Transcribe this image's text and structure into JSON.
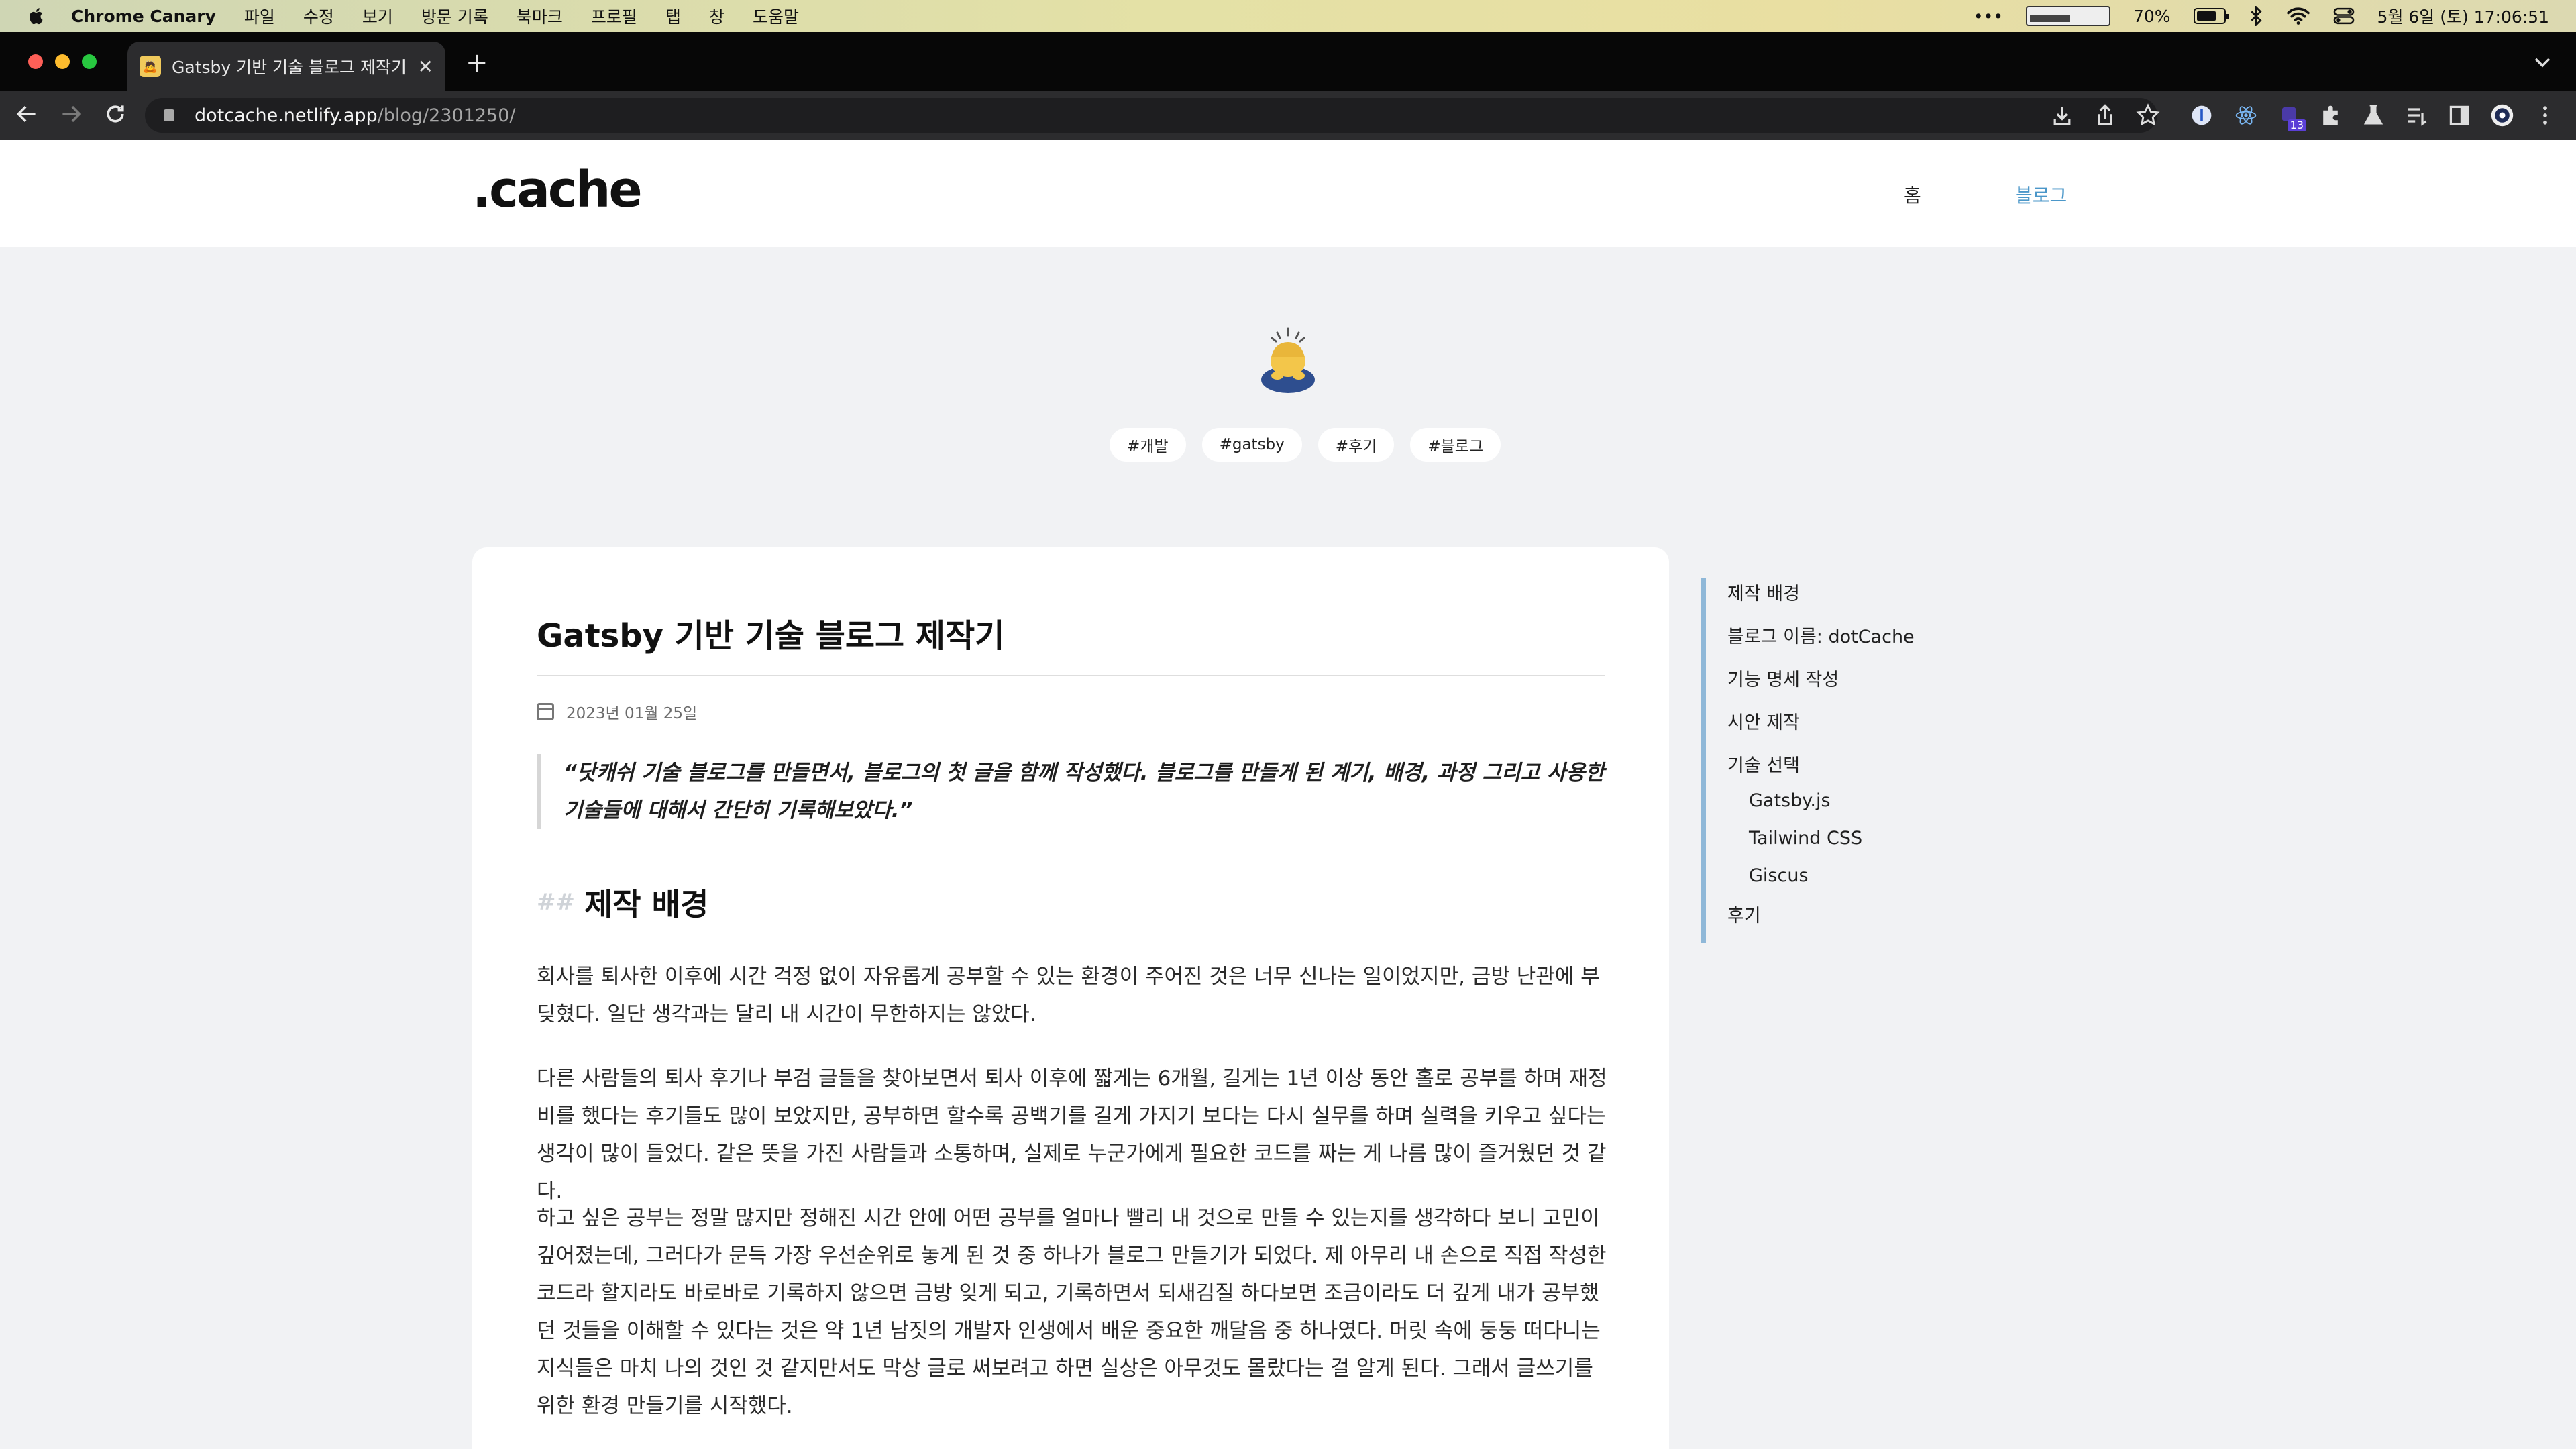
{
  "menubar": {
    "app_name": "Chrome Canary",
    "menus": [
      "파일",
      "수정",
      "보기",
      "방문 기록",
      "북마크",
      "프로필",
      "탭",
      "창",
      "도움말"
    ],
    "more": "•••",
    "battery_percent": "70%",
    "datetime": "5월 6일 (토) 17:06:51"
  },
  "browser": {
    "tab_title": "Gatsby 기반 기술 블로그 제작기 | d",
    "tab_close": "✕",
    "new_tab": "+",
    "url_host": "dotcache.netlify.app",
    "url_path": "/blog/2301250/",
    "extension_badge": "13"
  },
  "site": {
    "logo": ".cache",
    "nav": {
      "home": "홈",
      "blog": "블로그"
    },
    "hero_emoji": "🙇",
    "tags": [
      "#개발",
      "#gatsby",
      "#후기",
      "#블로그"
    ]
  },
  "post": {
    "title": "Gatsby 기반 기술 블로그 제작기",
    "date": "2023년 01월 25일",
    "quote": "“닷캐쉬 기술 블로그를 만들면서, 블로그의 첫 글을 함께 작성했다. 블로그를 만들게 된 계기, 배경, 과정 그리고 사용한 기술들에 대해서 간단히 기록해보았다.”",
    "section_hash": "##",
    "section_title": "제작 배경",
    "paragraphs": [
      "회사를 퇴사한 이후에 시간 걱정 없이 자유롭게 공부할 수 있는 환경이 주어진 것은 너무 신나는 일이었지만, 금방 난관에 부딪혔다. 일단 생각과는 달리 내 시간이 무한하지는 않았다.",
      "다른 사람들의 퇴사 후기나 부검 글들을 찾아보면서 퇴사 이후에 짧게는 6개월, 길게는 1년 이상 동안 홀로 공부를 하며 재정비를 했다는 후기들도 많이 보았지만, 공부하면 할수록 공백기를 길게 가지기 보다는 다시 실무를 하며 실력을 키우고 싶다는 생각이 많이 들었다. 같은 뜻을 가진 사람들과 소통하며, 실제로 누군가에게 필요한 코드를 짜는 게 나름 많이 즐거웠던 것 같다.",
      "하고 싶은 공부는 정말 많지만 정해진 시간 안에 어떤 공부를 얼마나 빨리 내 것으로 만들 수 있는지를 생각하다 보니 고민이 깊어졌는데, 그러다가 문득 가장 우선순위로 놓게 된 것 중 하나가 블로그 만들기가 되었다. 제 아무리 내 손으로 직접 작성한 코드라 할지라도 바로바로 기록하지 않으면 금방 잊게 되고, 기록하면서 되새김질 하다보면 조금이라도 더 깊게 내가 공부했던 것들을 이해할 수 있다는 것은 약 1년 남짓의 개발자 인생에서 배운 중요한 깨달음 중 하나였다. 머릿 속에 둥둥 떠다니는 지식들은 마치 나의 것인 것 같지만서도 막상 글로 써보려고 하면 실상은 아무것도 몰랐다는 걸 알게 된다. 그래서 글쓰기를 위한 환경 만들기를 시작했다."
    ]
  },
  "toc": {
    "items": [
      "제작 배경",
      "블로그 이름: dotCache",
      "기능 명세 작성",
      "시안 제작",
      "기술 선택"
    ],
    "sub_items": [
      "Gatsby.js",
      "Tailwind CSS",
      "Giscus"
    ],
    "last_item": "후기"
  },
  "colors": {
    "accent_blue": "#4b97c9",
    "toc_bar": "#8fb8d8",
    "page_bg": "#f1f2f4"
  }
}
